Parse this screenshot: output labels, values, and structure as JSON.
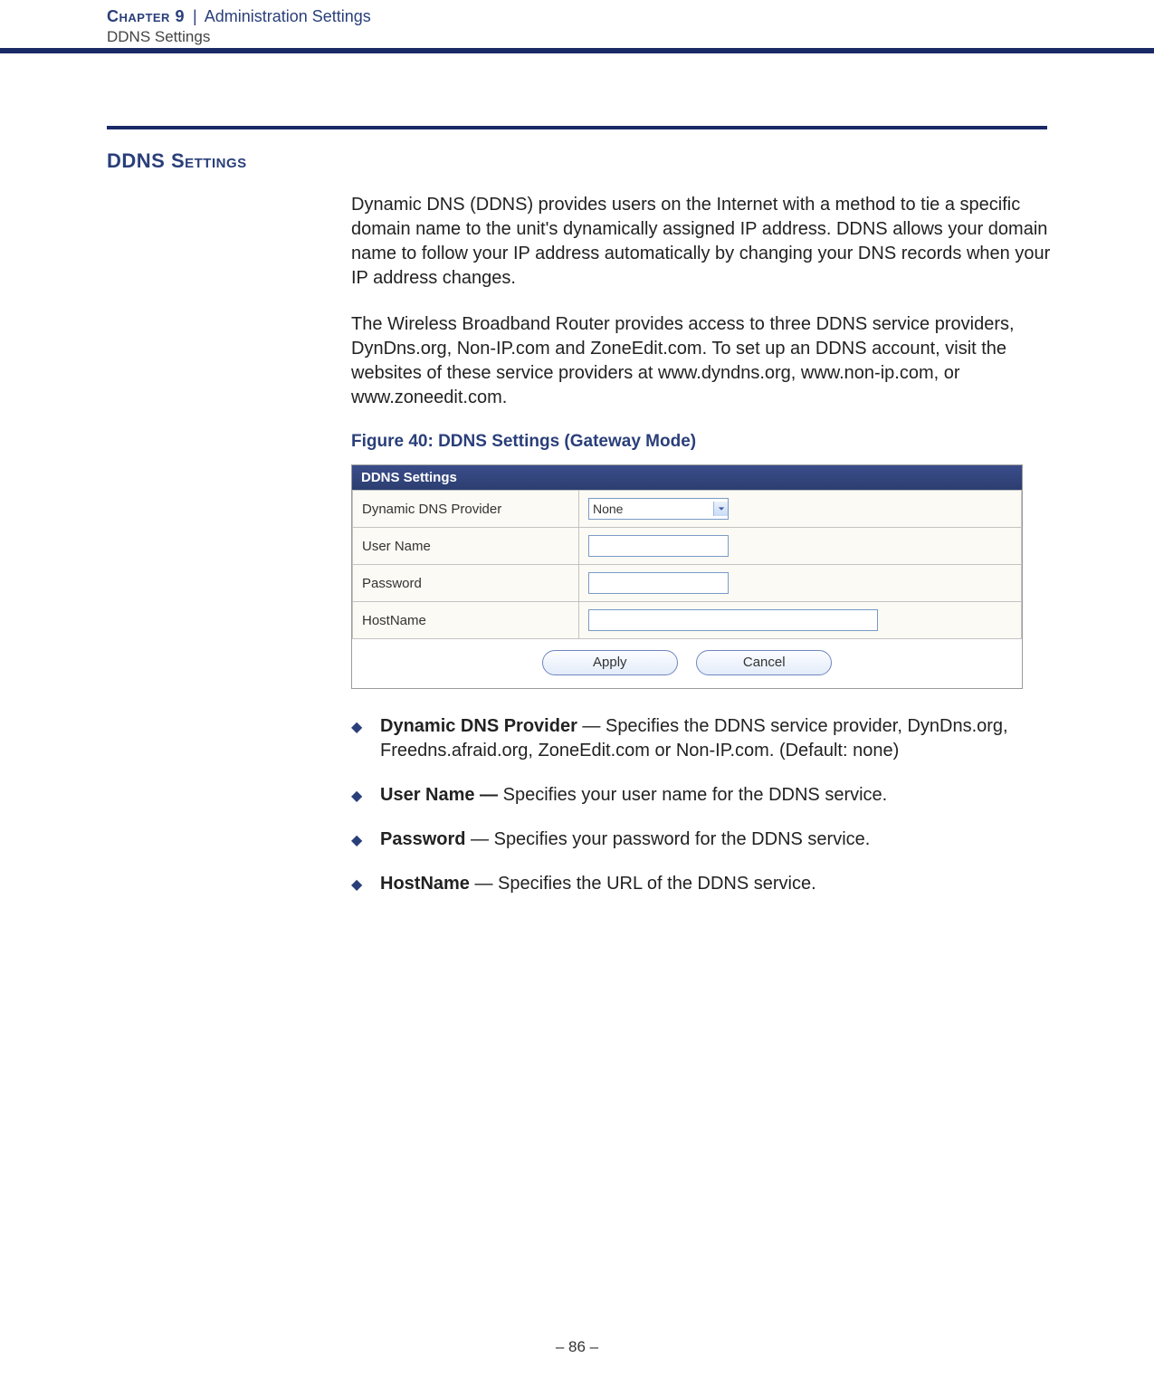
{
  "header": {
    "chapter_label": "Chapter 9",
    "separator": "|",
    "chapter_title": "Administration Settings",
    "subtitle": "DDNS Settings"
  },
  "section": {
    "title": "DDNS Settings"
  },
  "paragraphs": {
    "p1": "Dynamic DNS (DDNS) provides users on the Internet with a method to tie a specific domain name to the unit's dynamically assigned IP address. DDNS allows your domain name to follow your IP address automatically by changing your DNS records when your IP address changes.",
    "p2": "The Wireless Broadband Router provides access to three DDNS service providers, DynDns.org, Non-IP.com and ZoneEdit.com. To set up an DDNS account, visit the websites of these service providers at www.dyndns.org, www.non-ip.com, or www.zoneedit.com."
  },
  "figure": {
    "caption": "Figure 40:  DDNS Settings (Gateway Mode)"
  },
  "panel": {
    "title": "DDNS Settings",
    "rows": {
      "provider_label": "Dynamic DNS Provider",
      "provider_value": "None",
      "user_label": "User Name",
      "user_value": "",
      "password_label": "Password",
      "password_value": "",
      "host_label": "HostName",
      "host_value": ""
    },
    "buttons": {
      "apply": "Apply",
      "cancel": "Cancel"
    }
  },
  "bullets": {
    "b1_term": "Dynamic DNS Provider",
    "b1_rest": " — Specifies the DDNS service provider, DynDns.org, Freedns.afraid.org, ZoneEdit.com or Non-IP.com. (Default: none)",
    "b2_term": "User Name —",
    "b2_rest": " Specifies your user name for the DDNS service.",
    "b3_term": "Password",
    "b3_rest": " — Specifies your password for the DDNS service.",
    "b4_term": "HostName",
    "b4_rest": " — Specifies the URL of the DDNS service."
  },
  "footer": {
    "page": "–  86  –"
  }
}
